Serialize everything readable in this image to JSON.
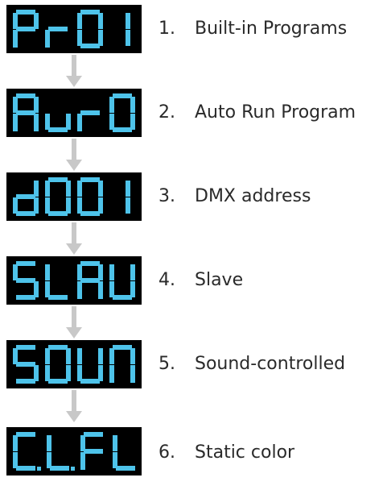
{
  "diagram": {
    "steps": [
      {
        "display": "Pr01",
        "number": "1.",
        "label": "Built-in Programs"
      },
      {
        "display": "AuTO",
        "number": "2.",
        "label": "Auto Run Program"
      },
      {
        "display": "d001",
        "number": "3.",
        "label": "DMX address"
      },
      {
        "display": "SLAU",
        "number": "4.",
        "label": "Slave"
      },
      {
        "display": "SOUN",
        "number": "5.",
        "label": "Sound-controlled"
      },
      {
        "display": "C.L.FL",
        "number": "6.",
        "label": "Static color"
      }
    ],
    "colors": {
      "lcd_background": "#000000",
      "lcd_segment": "#4ec3ea",
      "arrow": "#c8c8c8",
      "text": "#2a2a2a"
    }
  }
}
